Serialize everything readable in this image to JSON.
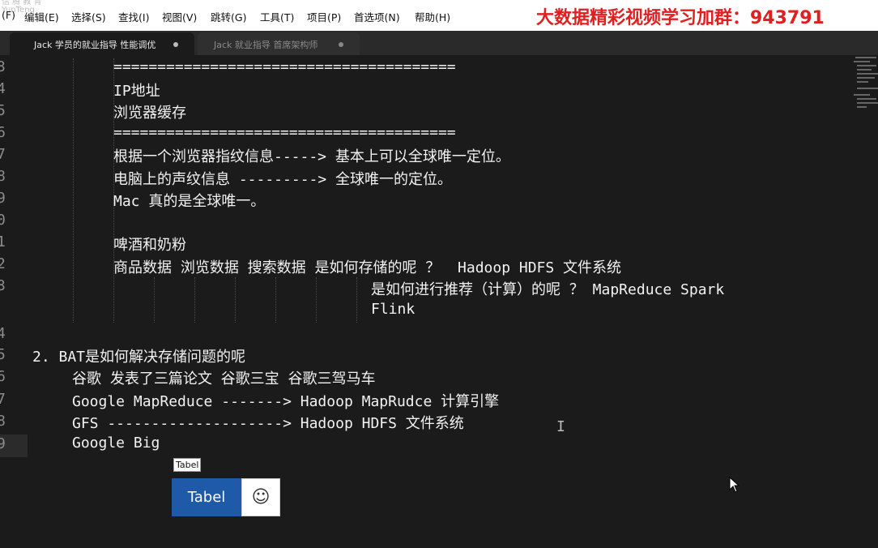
{
  "menubar": {
    "watermark": "信 腾 教 育\nYunTeng",
    "items": [
      "(F)",
      "编辑(E)",
      "选择(S)",
      "查找(I)",
      "视图(V)",
      "跳转(G)",
      "工具(T)",
      "项目(P)",
      "首选项(N)",
      "帮助(H)"
    ],
    "promo": "大数据精彩视频学习加群：943791"
  },
  "tabs": [
    {
      "label": "Jack 学员的就业指导 性能调优"
    },
    {
      "label": "Jack 就业指导 首席架构师"
    }
  ],
  "editor": {
    "line_numbers": [
      "3",
      "4",
      "5",
      "6",
      "7",
      "8",
      "9",
      "0",
      "1",
      "2",
      "3",
      "",
      "4",
      "5",
      "6",
      "7",
      "8",
      "9"
    ],
    "lines": [
      "=======================================",
      "IP地址",
      "浏览器缓存",
      "=======================================",
      "根据一个浏览器指纹信息-----> 基本上可以全球唯一定位。",
      "电脑上的声纹信息 ---------> 全球唯一的定位。",
      "Mac 真的是全球唯一。",
      "",
      "啤酒和奶粉",
      "商品数据 浏览数据 搜索数据 是如何存储的呢 ？  Hadoop HDFS 文件系统",
      "是如何进行推荐（计算）的呢 ？ MapReduce Spark",
      "Flink",
      "",
      "2. BAT是如何解决存储问题的呢",
      "谷歌 发表了三篇论文 谷歌三宝 谷歌三驾马车",
      "Google MapReduce -------> Hadoop MapRudce 计算引擎",
      "GFS --------------------> Hadoop HDFS 文件系统",
      "Google Big"
    ],
    "cursor_glyph": "I"
  },
  "tooltip": {
    "text": "Tabel"
  },
  "button": {
    "label": "Tabel",
    "emoji": "☺"
  }
}
